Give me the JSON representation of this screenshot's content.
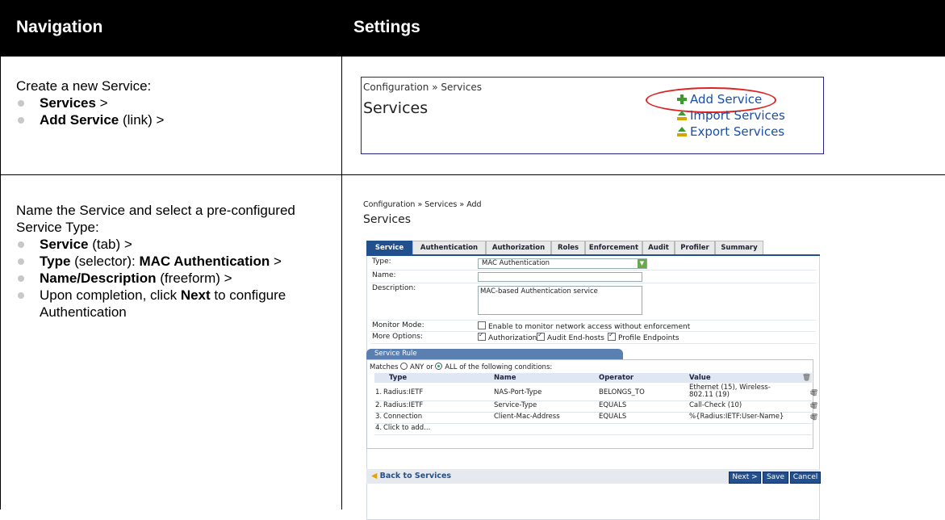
{
  "header": {
    "col1": "Navigation",
    "col2": "Settings"
  },
  "row1": {
    "intro": "Create a new Service:",
    "steps": [
      {
        "bold": "Services",
        "rest": " >"
      },
      {
        "bold": "Add Service",
        "rest": " (link) >"
      }
    ],
    "screen": {
      "breadcrumb": "Configuration » Services",
      "title": "Services",
      "links": [
        "Add Service",
        "Import Services",
        "Export Services"
      ]
    }
  },
  "row2": {
    "intro": "Name the Service and select a pre-configured Service Type:",
    "steps": [
      {
        "bold": "Service",
        "rest": " (tab) >"
      },
      {
        "bold": "Type",
        "rest": " (selector): ",
        "bold2": "MAC Authentication",
        "rest2": " >"
      },
      {
        "bold": "Name/Description",
        "rest": " (freeform) >"
      },
      {
        "pre": "Upon completion, click ",
        "bold": "Next",
        "rest": " to configure Authentication"
      }
    ],
    "screen": {
      "breadcrumb": "Configuration » Services » Add",
      "title": "Services",
      "tabs": [
        "Service",
        "Authentication",
        "Authorization",
        "Roles",
        "Enforcement",
        "Audit",
        "Profiler",
        "Summary"
      ],
      "active_tab": "Service",
      "fields": {
        "type_label": "Type:",
        "type_value": "MAC Authentication",
        "name_label": "Name:",
        "name_value": "",
        "description_label": "Description:",
        "description_value": "MAC-based Authentication service",
        "monitor_label": "Monitor Mode:",
        "monitor_text": "Enable to monitor network access without enforcement",
        "monitor_checked": false,
        "more_label": "More Options:",
        "more_options": [
          {
            "label": "Authorization",
            "checked": true
          },
          {
            "label": "Audit End-hosts",
            "checked": true
          },
          {
            "label": "Profile Endpoints",
            "checked": true
          }
        ]
      },
      "rule": {
        "header": "Service Rule",
        "matches_prefix": "Matches",
        "any": "ANY",
        "or": "or",
        "all": "ALL",
        "matches_suffix": "of the following conditions:",
        "selected": "ALL",
        "columns": [
          "Type",
          "Name",
          "Operator",
          "Value"
        ],
        "rows": [
          {
            "num": "1.",
            "type": "Radius:IETF",
            "name": "NAS-Port-Type",
            "operator": "BELONGS_TO",
            "value": "Ethernet (15), Wireless-802.11 (19)"
          },
          {
            "num": "2.",
            "type": "Radius:IETF",
            "name": "Service-Type",
            "operator": "EQUALS",
            "value": "Call-Check (10)"
          },
          {
            "num": "3.",
            "type": "Connection",
            "name": "Client-Mac-Address",
            "operator": "EQUALS",
            "value": "%{Radius:IETF:User-Name}"
          },
          {
            "num": "4.",
            "type": "Click to add...",
            "name": "",
            "operator": "",
            "value": ""
          }
        ]
      },
      "footer": {
        "back": "Back to Services",
        "next": "Next >",
        "save": "Save",
        "cancel": "Cancel"
      }
    }
  }
}
